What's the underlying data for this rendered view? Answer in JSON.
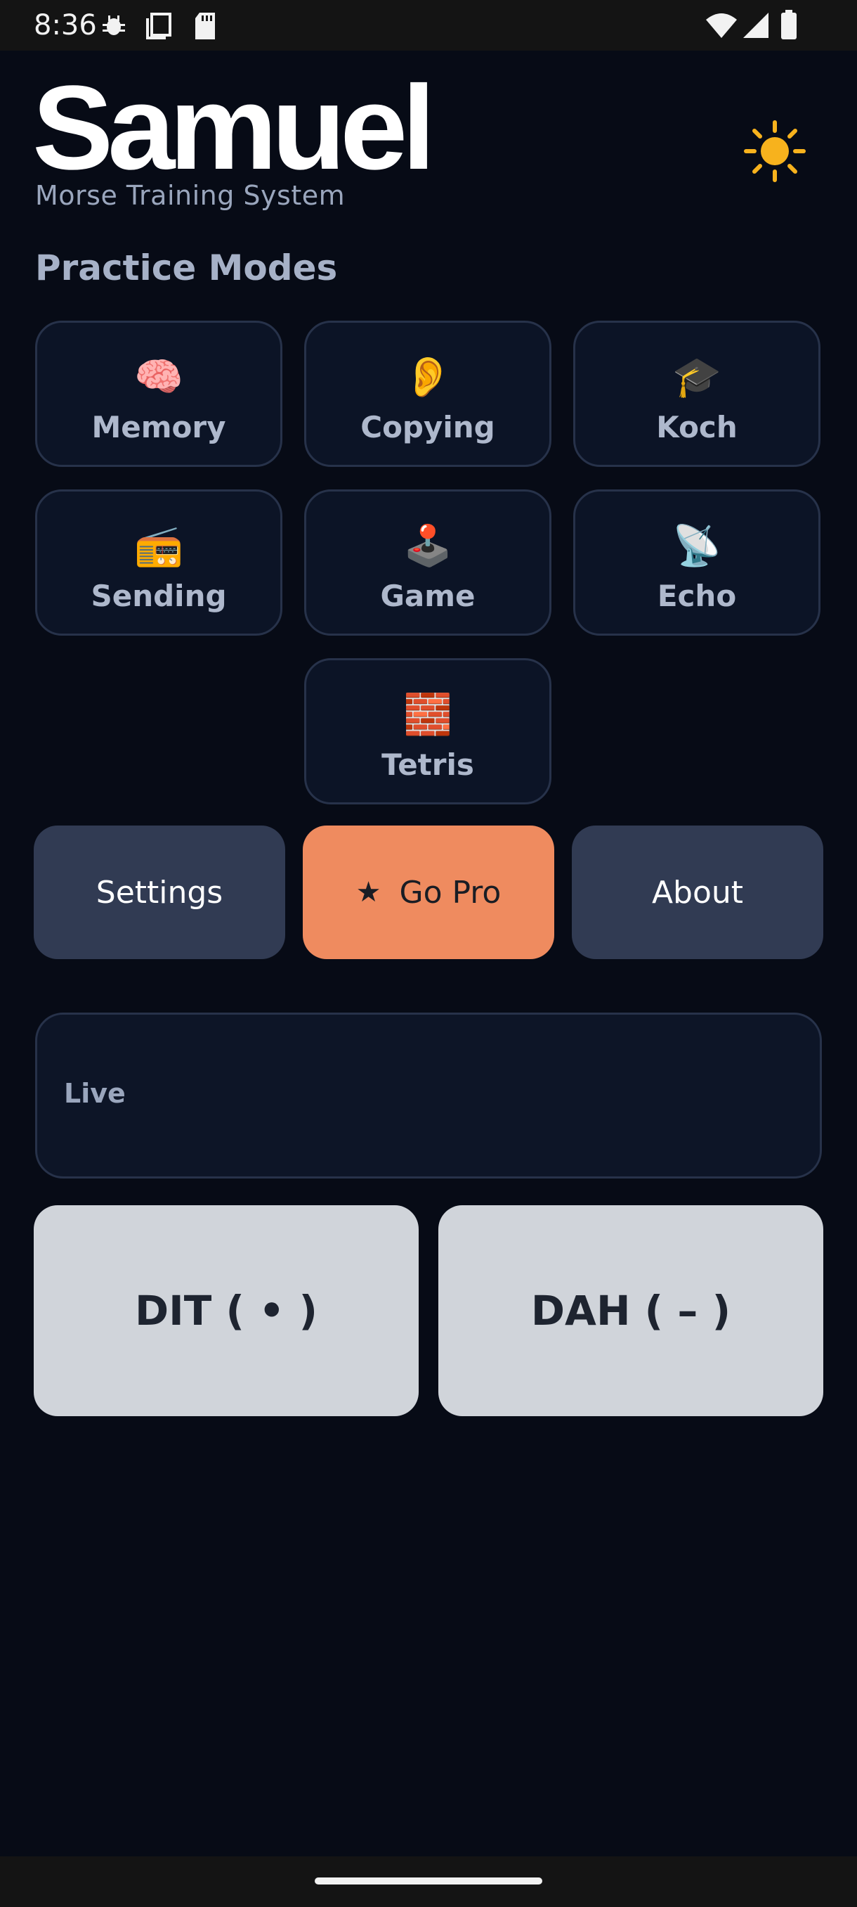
{
  "status_bar": {
    "time": "8:36"
  },
  "header": {
    "logo_text": "Samuel",
    "subtitle": "Morse Training System",
    "theme_icon": "sun-icon"
  },
  "practice": {
    "heading": "Practice Modes",
    "modes": [
      {
        "label": "Memory",
        "icon": "🧠"
      },
      {
        "label": "Copying",
        "icon": "👂"
      },
      {
        "label": "Koch",
        "icon": "🎓"
      },
      {
        "label": "Sending",
        "icon": "📻"
      },
      {
        "label": "Game",
        "icon": "🕹️"
      },
      {
        "label": "Echo",
        "icon": "📡"
      },
      {
        "label": "Tetris",
        "icon": "🧱"
      }
    ]
  },
  "actions": {
    "settings": "Settings",
    "go_pro_star": "★",
    "go_pro": "Go Pro",
    "about": "About"
  },
  "live": {
    "label": "Live"
  },
  "keys": {
    "dit": "DIT ( • )",
    "dah": "DAH ( – )"
  },
  "colors": {
    "background": "#070b16",
    "tile_background": "#0c1426",
    "tile_border": "#27324a",
    "action_button": "#313b53",
    "pro_accent": "#ef8b5f",
    "key_button": "#d0d4da"
  }
}
